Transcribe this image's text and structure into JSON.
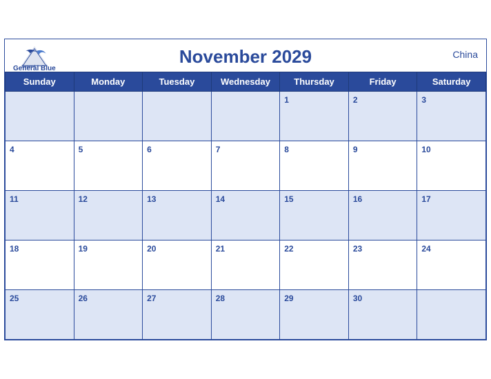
{
  "header": {
    "title": "November 2029",
    "brand": "General Blue",
    "country": "China"
  },
  "weekdays": [
    "Sunday",
    "Monday",
    "Tuesday",
    "Wednesday",
    "Thursday",
    "Friday",
    "Saturday"
  ],
  "weeks": [
    [
      null,
      null,
      null,
      null,
      1,
      2,
      3
    ],
    [
      4,
      5,
      6,
      7,
      8,
      9,
      10
    ],
    [
      11,
      12,
      13,
      14,
      15,
      16,
      17
    ],
    [
      18,
      19,
      20,
      21,
      22,
      23,
      24
    ],
    [
      25,
      26,
      27,
      28,
      29,
      30,
      null
    ]
  ]
}
